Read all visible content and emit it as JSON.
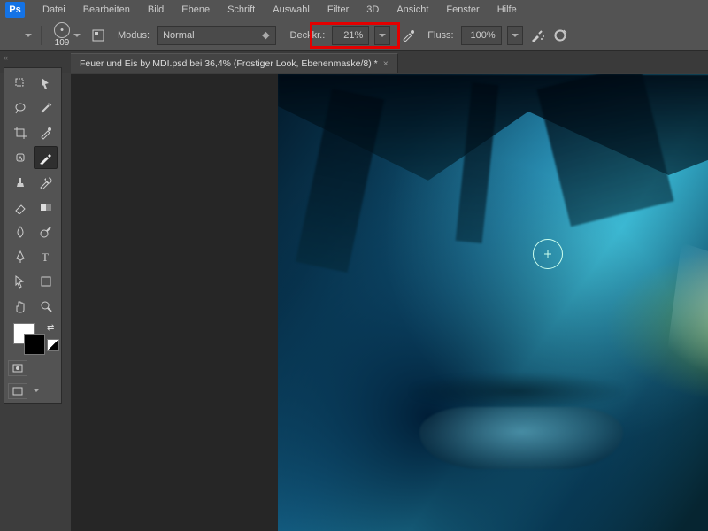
{
  "app": {
    "logo": "Ps"
  },
  "menu": {
    "items": [
      "Datei",
      "Bearbeiten",
      "Bild",
      "Ebene",
      "Schrift",
      "Auswahl",
      "Filter",
      "3D",
      "Ansicht",
      "Fenster",
      "Hilfe"
    ]
  },
  "options": {
    "brush_size": "109",
    "mode_label": "Modus:",
    "mode_value": "Normal",
    "opacity_label": "Deckkr.:",
    "opacity_value": "21%",
    "flow_label": "Fluss:",
    "flow_value": "100%"
  },
  "document": {
    "tab_title": "Feuer und Eis by MDI.psd bei 36,4% (Frostiger Look, Ebenenmaske/8) *"
  }
}
